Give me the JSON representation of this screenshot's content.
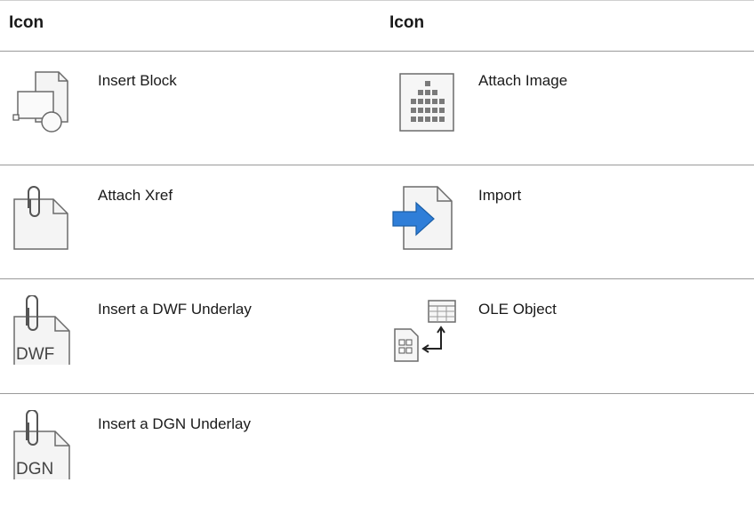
{
  "header": {
    "col1": "Icon",
    "col2": "Icon"
  },
  "rows": [
    {
      "left": {
        "icon": "insert-block-icon",
        "label": "Insert Block"
      },
      "right": {
        "icon": "attach-image-icon",
        "label": "Attach Image"
      }
    },
    {
      "left": {
        "icon": "attach-xref-icon",
        "label": "Attach Xref"
      },
      "right": {
        "icon": "import-icon",
        "label": "Import"
      }
    },
    {
      "left": {
        "icon": "dwf-underlay-icon",
        "label": "Insert a DWF Underlay",
        "icon_text": "DWF"
      },
      "right": {
        "icon": "ole-object-icon",
        "label": "OLE Object"
      }
    },
    {
      "left": {
        "icon": "dgn-underlay-icon",
        "label": "Insert a DGN Underlay",
        "icon_text": "DGN"
      }
    }
  ],
  "colors": {
    "rule": "#9a9a9a",
    "icon_stroke": "#6b6b6b",
    "arrow_blue": "#2f7ed8"
  }
}
